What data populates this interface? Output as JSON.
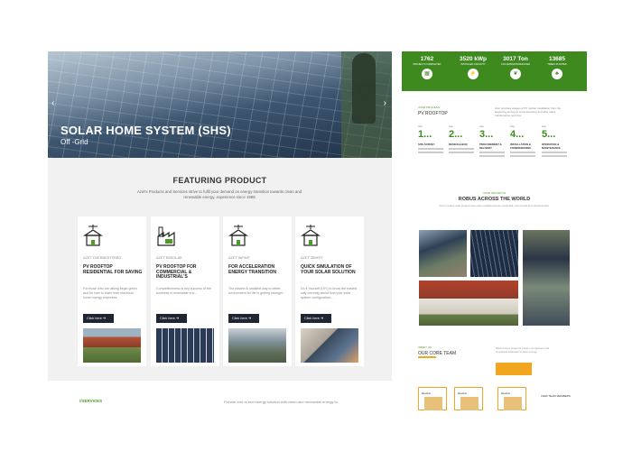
{
  "hero": {
    "title": "SOLAR HOME SYSTEM (SHS)",
    "subtitle": "Off -Grid",
    "prev_icon": "chevron-left-icon",
    "next_icon": "chevron-right-icon"
  },
  "featuring": {
    "title": "FEATURING PRODUCT",
    "description": "Azet's Products and Services strive to fulfil your demand on energy transition towards clean and renewable energy, experience since 1988"
  },
  "cards": [
    {
      "tag": "AZET OVERNIGHT/EBG",
      "title": "PV ROOFTOP RESIDENTIAL FOR SAVING",
      "text": "For those who are willing begin green and for now to lower their electrical home energy expenses...",
      "button": "Click here ➔",
      "icon": "house-solar-icon",
      "img": "residential-house-image"
    },
    {
      "tag": "AZET EBSOLAR",
      "title": "PV ROOFTOP FOR COMMERCIAL & INDUSTRIAL'S",
      "text": "Competitiveness is key success of the business in renewable era...",
      "button": "Click here ➔",
      "icon": "factory-solar-icon",
      "img": "solar-array-image"
    },
    {
      "tag": "AZET INFINIT",
      "title": "FOR ACCELERATION ENERGY TRANSITION",
      "text": "The easiest & smallest way to better environment for life is getting stronger...",
      "button": "Click here ➔",
      "icon": "house-solar-icon",
      "img": "rooftop-aerial-image"
    },
    {
      "tag": "AZET ZBHRIT",
      "title": "QUICK SIMULATION OF YOUR SOLAR SOLUTION",
      "text": "Do it Yourself (DIY) to know the easiest way correctly about how your solar system configuration...",
      "button": "Click here ➔",
      "icon": "house-solar-icon",
      "img": "laptop-simulation-image"
    }
  ],
  "footer": {
    "services": "//SERVICES",
    "tagline": "Provide end to end energy solution with clean and renewable energy to"
  },
  "stats": [
    {
      "value": "1762",
      "label": "PROJECTS COMPLETED",
      "icon": "solar-panel-icon"
    },
    {
      "value": "3520 kWp",
      "label": "INSTALLED CAPACITY",
      "icon": "lightning-icon"
    },
    {
      "value": "3017 Ton",
      "label": "CO2 EMISSION REDUCED",
      "icon": "leaf-icon"
    },
    {
      "value": "13685",
      "label": "TREES PLANTED",
      "icon": "tree-icon"
    }
  ],
  "steps": {
    "label": "//OUR PROCESS",
    "title": "PV ROOFTOP",
    "description": "Azet provides stages of PV rooftop installation from the beginning survey to commissioning and after sales maintenance services.",
    "items": [
      {
        "small": "step",
        "num": "1...",
        "name": "SITE SURVEY"
      },
      {
        "small": "step",
        "num": "2...",
        "name": "DESIGN & BOQ"
      },
      {
        "small": "step",
        "num": "3...",
        "name": "PROCUREMENT & DELIVERY"
      },
      {
        "small": "step",
        "num": "4...",
        "name": "INSTALLATION & COMMISSIONING"
      },
      {
        "small": "step",
        "num": "5...",
        "name": "OPERATION & MAINTENANCE"
      }
    ]
  },
  "robus": {
    "label": "//OUR PROJECTS",
    "title": "ROBUS ACROSS THE WORLD",
    "description": "Azet's rooftop solar projects have been installed across residential, commercial and industrial sites."
  },
  "team": {
    "label": "//MEET US",
    "title": "OUR CORE TEAM",
    "description": "Behind every project is a team of engineers and specialists dedicated to clean energy.",
    "members": [
      "Member",
      "Member",
      "Member"
    ],
    "more": "VIEW TEAM MEMBERS"
  }
}
